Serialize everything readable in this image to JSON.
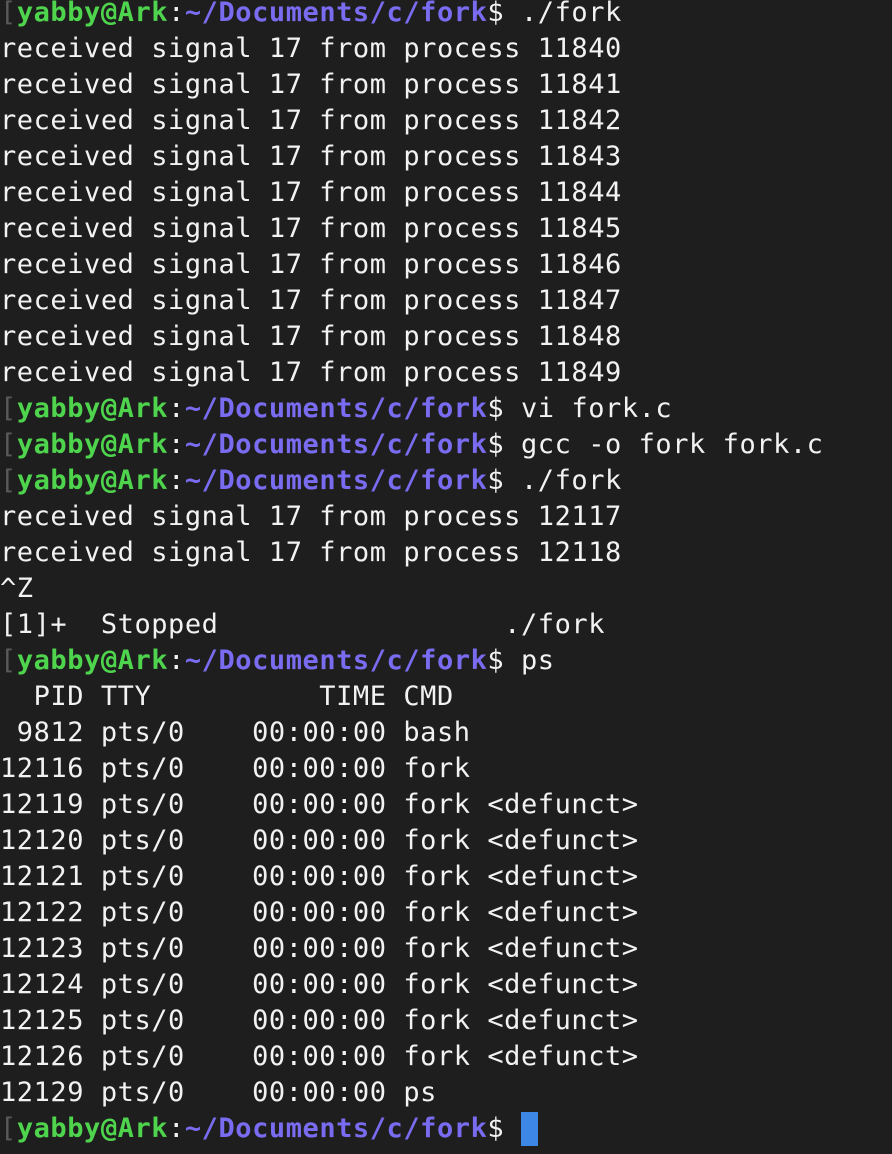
{
  "terminal": {
    "prompt": {
      "bracket": "[",
      "user_host": "yabby@Ark",
      "colon": ":",
      "path": "~/Documents/c/fork",
      "dollar": "$"
    },
    "colors": {
      "background": "#1e1e1e",
      "text": "#f2f2f2",
      "user_host": "#4fd44d",
      "path": "#7a6cf0",
      "cursor": "#3d87e6"
    },
    "lines": [
      {
        "kind": "prompt",
        "command": " ./fork"
      },
      {
        "kind": "output",
        "text": "received signal 17 from process 11840"
      },
      {
        "kind": "output",
        "text": "received signal 17 from process 11841"
      },
      {
        "kind": "output",
        "text": "received signal 17 from process 11842"
      },
      {
        "kind": "output",
        "text": "received signal 17 from process 11843"
      },
      {
        "kind": "output",
        "text": "received signal 17 from process 11844"
      },
      {
        "kind": "output",
        "text": "received signal 17 from process 11845"
      },
      {
        "kind": "output",
        "text": "received signal 17 from process 11846"
      },
      {
        "kind": "output",
        "text": "received signal 17 from process 11847"
      },
      {
        "kind": "output",
        "text": "received signal 17 from process 11848"
      },
      {
        "kind": "output",
        "text": "received signal 17 from process 11849"
      },
      {
        "kind": "prompt",
        "command": " vi fork.c"
      },
      {
        "kind": "prompt",
        "command": " gcc -o fork fork.c"
      },
      {
        "kind": "prompt",
        "command": " ./fork"
      },
      {
        "kind": "output",
        "text": "received signal 17 from process 12117"
      },
      {
        "kind": "output",
        "text": "received signal 17 from process 12118"
      },
      {
        "kind": "output",
        "text": "^Z"
      },
      {
        "kind": "output",
        "text": "[1]+  Stopped                 ./fork"
      },
      {
        "kind": "prompt",
        "command": " ps"
      },
      {
        "kind": "output",
        "text": "  PID TTY          TIME CMD"
      },
      {
        "kind": "output",
        "text": " 9812 pts/0    00:00:00 bash"
      },
      {
        "kind": "output",
        "text": "12116 pts/0    00:00:00 fork"
      },
      {
        "kind": "output",
        "text": "12119 pts/0    00:00:00 fork <defunct>"
      },
      {
        "kind": "output",
        "text": "12120 pts/0    00:00:00 fork <defunct>"
      },
      {
        "kind": "output",
        "text": "12121 pts/0    00:00:00 fork <defunct>"
      },
      {
        "kind": "output",
        "text": "12122 pts/0    00:00:00 fork <defunct>"
      },
      {
        "kind": "output",
        "text": "12123 pts/0    00:00:00 fork <defunct>"
      },
      {
        "kind": "output",
        "text": "12124 pts/0    00:00:00 fork <defunct>"
      },
      {
        "kind": "output",
        "text": "12125 pts/0    00:00:00 fork <defunct>"
      },
      {
        "kind": "output",
        "text": "12126 pts/0    00:00:00 fork <defunct>"
      },
      {
        "kind": "output",
        "text": "12129 pts/0    00:00:00 ps"
      },
      {
        "kind": "prompt",
        "command": " ",
        "cursor": true
      }
    ]
  }
}
